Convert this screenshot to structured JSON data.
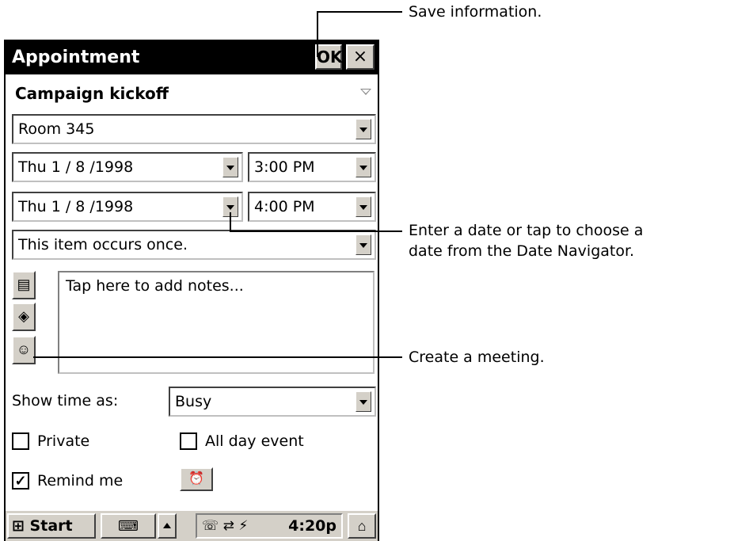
{
  "window": {
    "title": "Appointment",
    "ok_label": "OK",
    "close_label": "×"
  },
  "appointment": {
    "subject": "Campaign kickoff",
    "location": "Room 345",
    "start_date": "Thu  1 / 8 /1998",
    "start_time": "3:00 PM",
    "end_date": "Thu  1 / 8 /1998",
    "end_time": "4:00 PM",
    "recurrence": "This item occurs once.",
    "notes_placeholder": "Tap here to add notes...",
    "show_time_label": "Show time as:",
    "show_time_value": "Busy",
    "private_label": "Private",
    "private_checked": false,
    "all_day_label": "All day event",
    "all_day_checked": false,
    "remind_label": "Remind me",
    "remind_checked": true
  },
  "icons": {
    "notes_tab": "notebook-icon",
    "recurrence_tab": "tag-icon",
    "attendees_tab": "people-icon",
    "reminder": "alarm-icon"
  },
  "taskbar": {
    "start_label": "Start",
    "clock": "4:20p"
  },
  "callouts": {
    "save": "Save information.",
    "date_line1": "Enter a date or tap to choose a",
    "date_line2": "date from the Date Navigator.",
    "meeting": "Create a meeting."
  }
}
